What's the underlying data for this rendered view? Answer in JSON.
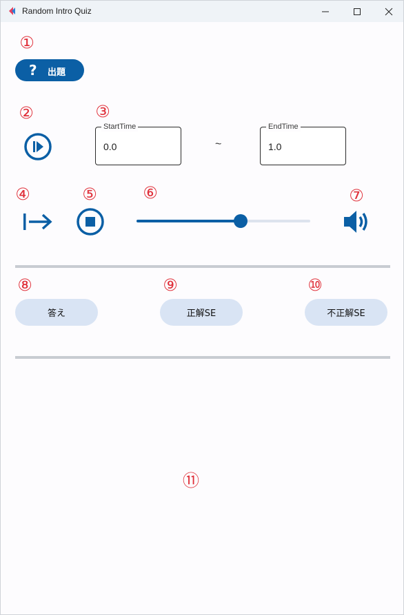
{
  "window": {
    "title": "Random Intro Quiz",
    "icon": "app-icon"
  },
  "markers": {
    "m1": "①",
    "m2": "②",
    "m3": "③",
    "m4": "④",
    "m5": "⑤",
    "m6": "⑥",
    "m7": "⑦",
    "m8": "⑧",
    "m9": "⑨",
    "m10": "⑩",
    "m11": "⑪"
  },
  "ask_button": {
    "icon": "question-icon",
    "icon_glyph": "?",
    "label": "出題"
  },
  "playback": {
    "play_from_start_icon": "play-circle-icon",
    "start_time": {
      "label": "StartTime",
      "value": "0.0"
    },
    "range_separator": "~",
    "end_time": {
      "label": "EndTime",
      "value": "1.0"
    }
  },
  "controls": {
    "skip_icon": "skip-to-end-icon",
    "stop_icon": "stop-circle-icon",
    "volume_level": 0.6,
    "volume_icon": "speaker-icon"
  },
  "answer_row": {
    "answer_label": "答え",
    "correct_se_label": "正解SE",
    "incorrect_se_label": "不正解SE"
  },
  "colors": {
    "accent": "#0b5fa5",
    "marker": "#e0303a",
    "pill": "#d9e4f4",
    "divider": "#c8ccd2"
  }
}
